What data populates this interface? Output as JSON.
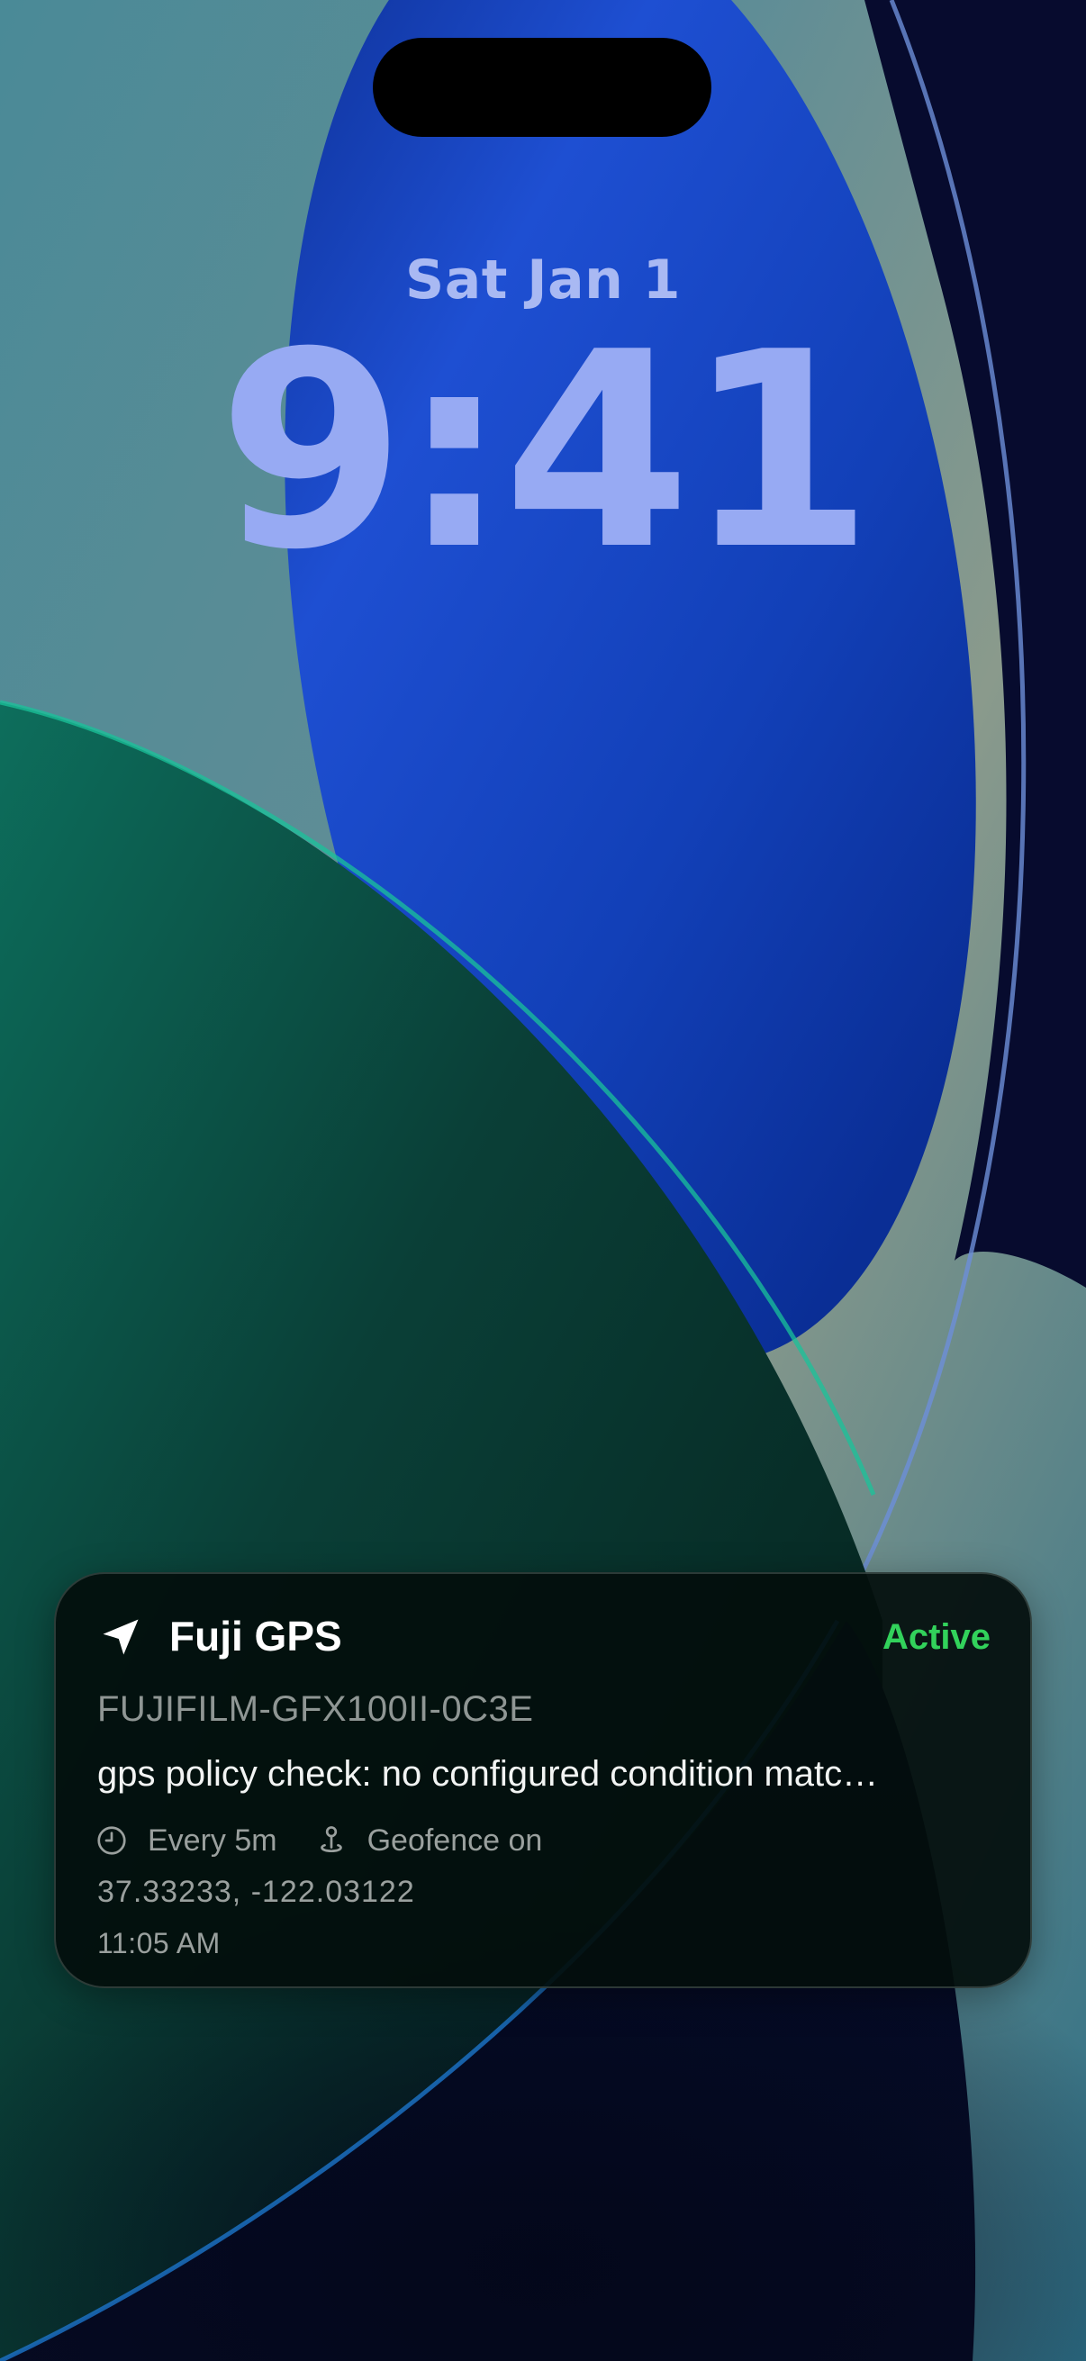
{
  "lock_screen": {
    "date": "Sat Jan 1",
    "time": "9:41"
  },
  "notification": {
    "app_icon": "location-arrow-icon",
    "app_name": "Fuji GPS",
    "status": "Active",
    "status_color": "#32d25b",
    "device_id": "FUJIFILM-GFX100II-0C3E",
    "message": "gps policy check: no configured condition matc…",
    "interval_icon": "clock-icon",
    "interval": "Every 5m",
    "geofence_icon": "pin-icon",
    "geofence": "Geofence on",
    "coordinates": "37.33233, -122.03122",
    "timestamp": "11:05 AM"
  }
}
